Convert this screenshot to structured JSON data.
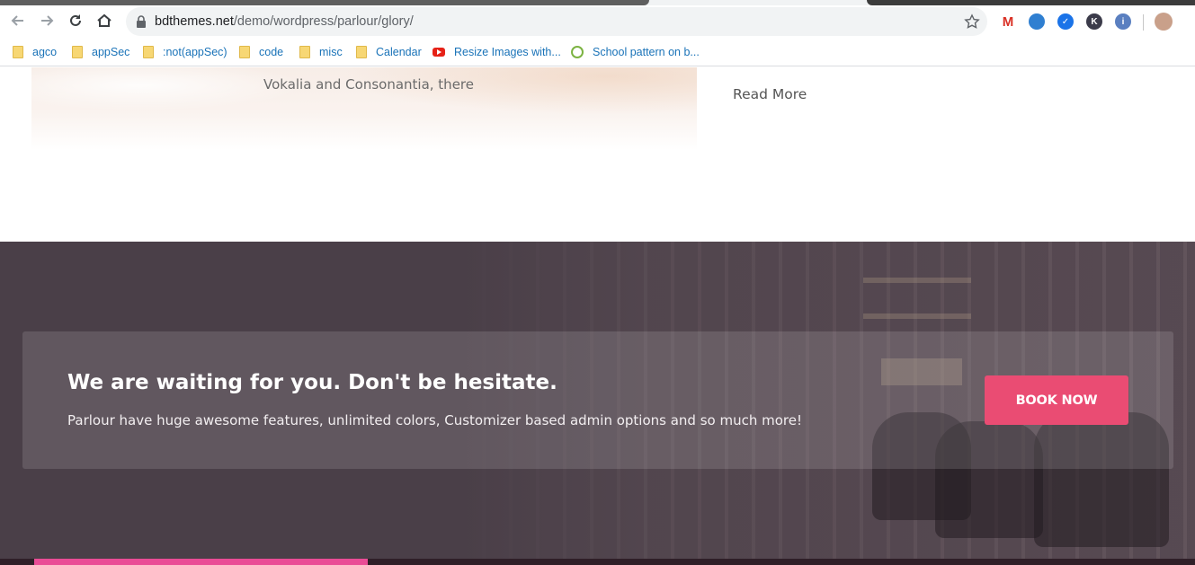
{
  "browser": {
    "url_host": "bdthemes.net",
    "url_path": "/demo/wordpress/parlour/glory/",
    "bookmarks": [
      {
        "label": "agco",
        "icon": "folder-icon"
      },
      {
        "label": "appSec",
        "icon": "folder-icon"
      },
      {
        "label": ":not(appSec)",
        "icon": "folder-icon"
      },
      {
        "label": "code",
        "icon": "folder-icon"
      },
      {
        "label": "misc",
        "icon": "folder-icon"
      },
      {
        "label": "Calendar",
        "icon": "folder-icon"
      },
      {
        "label": "Resize Images with...",
        "icon": "youtube-icon"
      },
      {
        "label": "School pattern on b...",
        "icon": "school-icon"
      }
    ],
    "extensions": [
      {
        "name": "gmail-icon",
        "color": "#d93025",
        "text": "M"
      },
      {
        "name": "earth-icon",
        "color": "#2f7fd1",
        "text": ""
      },
      {
        "name": "check-icon",
        "color": "#1a73e8",
        "text": "✓"
      },
      {
        "name": "k-extension-icon",
        "color": "#3b3b4a",
        "text": "K"
      },
      {
        "name": "info-extension-icon",
        "color": "#5a7fc0",
        "text": "i"
      },
      {
        "name": "profile-avatar",
        "color": "#c9a08a",
        "text": ""
      }
    ]
  },
  "page": {
    "blog_caption": "Vokalia and Consonantia, there",
    "read_more": "Read More"
  },
  "cta": {
    "title": "We are waiting for you. Don't be hesitate.",
    "subtitle": "Parlour have huge awesome features, unlimited colors, Customizer based admin options and so much more!",
    "button": "BOOK NOW",
    "accent_color": "#ea4c73"
  }
}
